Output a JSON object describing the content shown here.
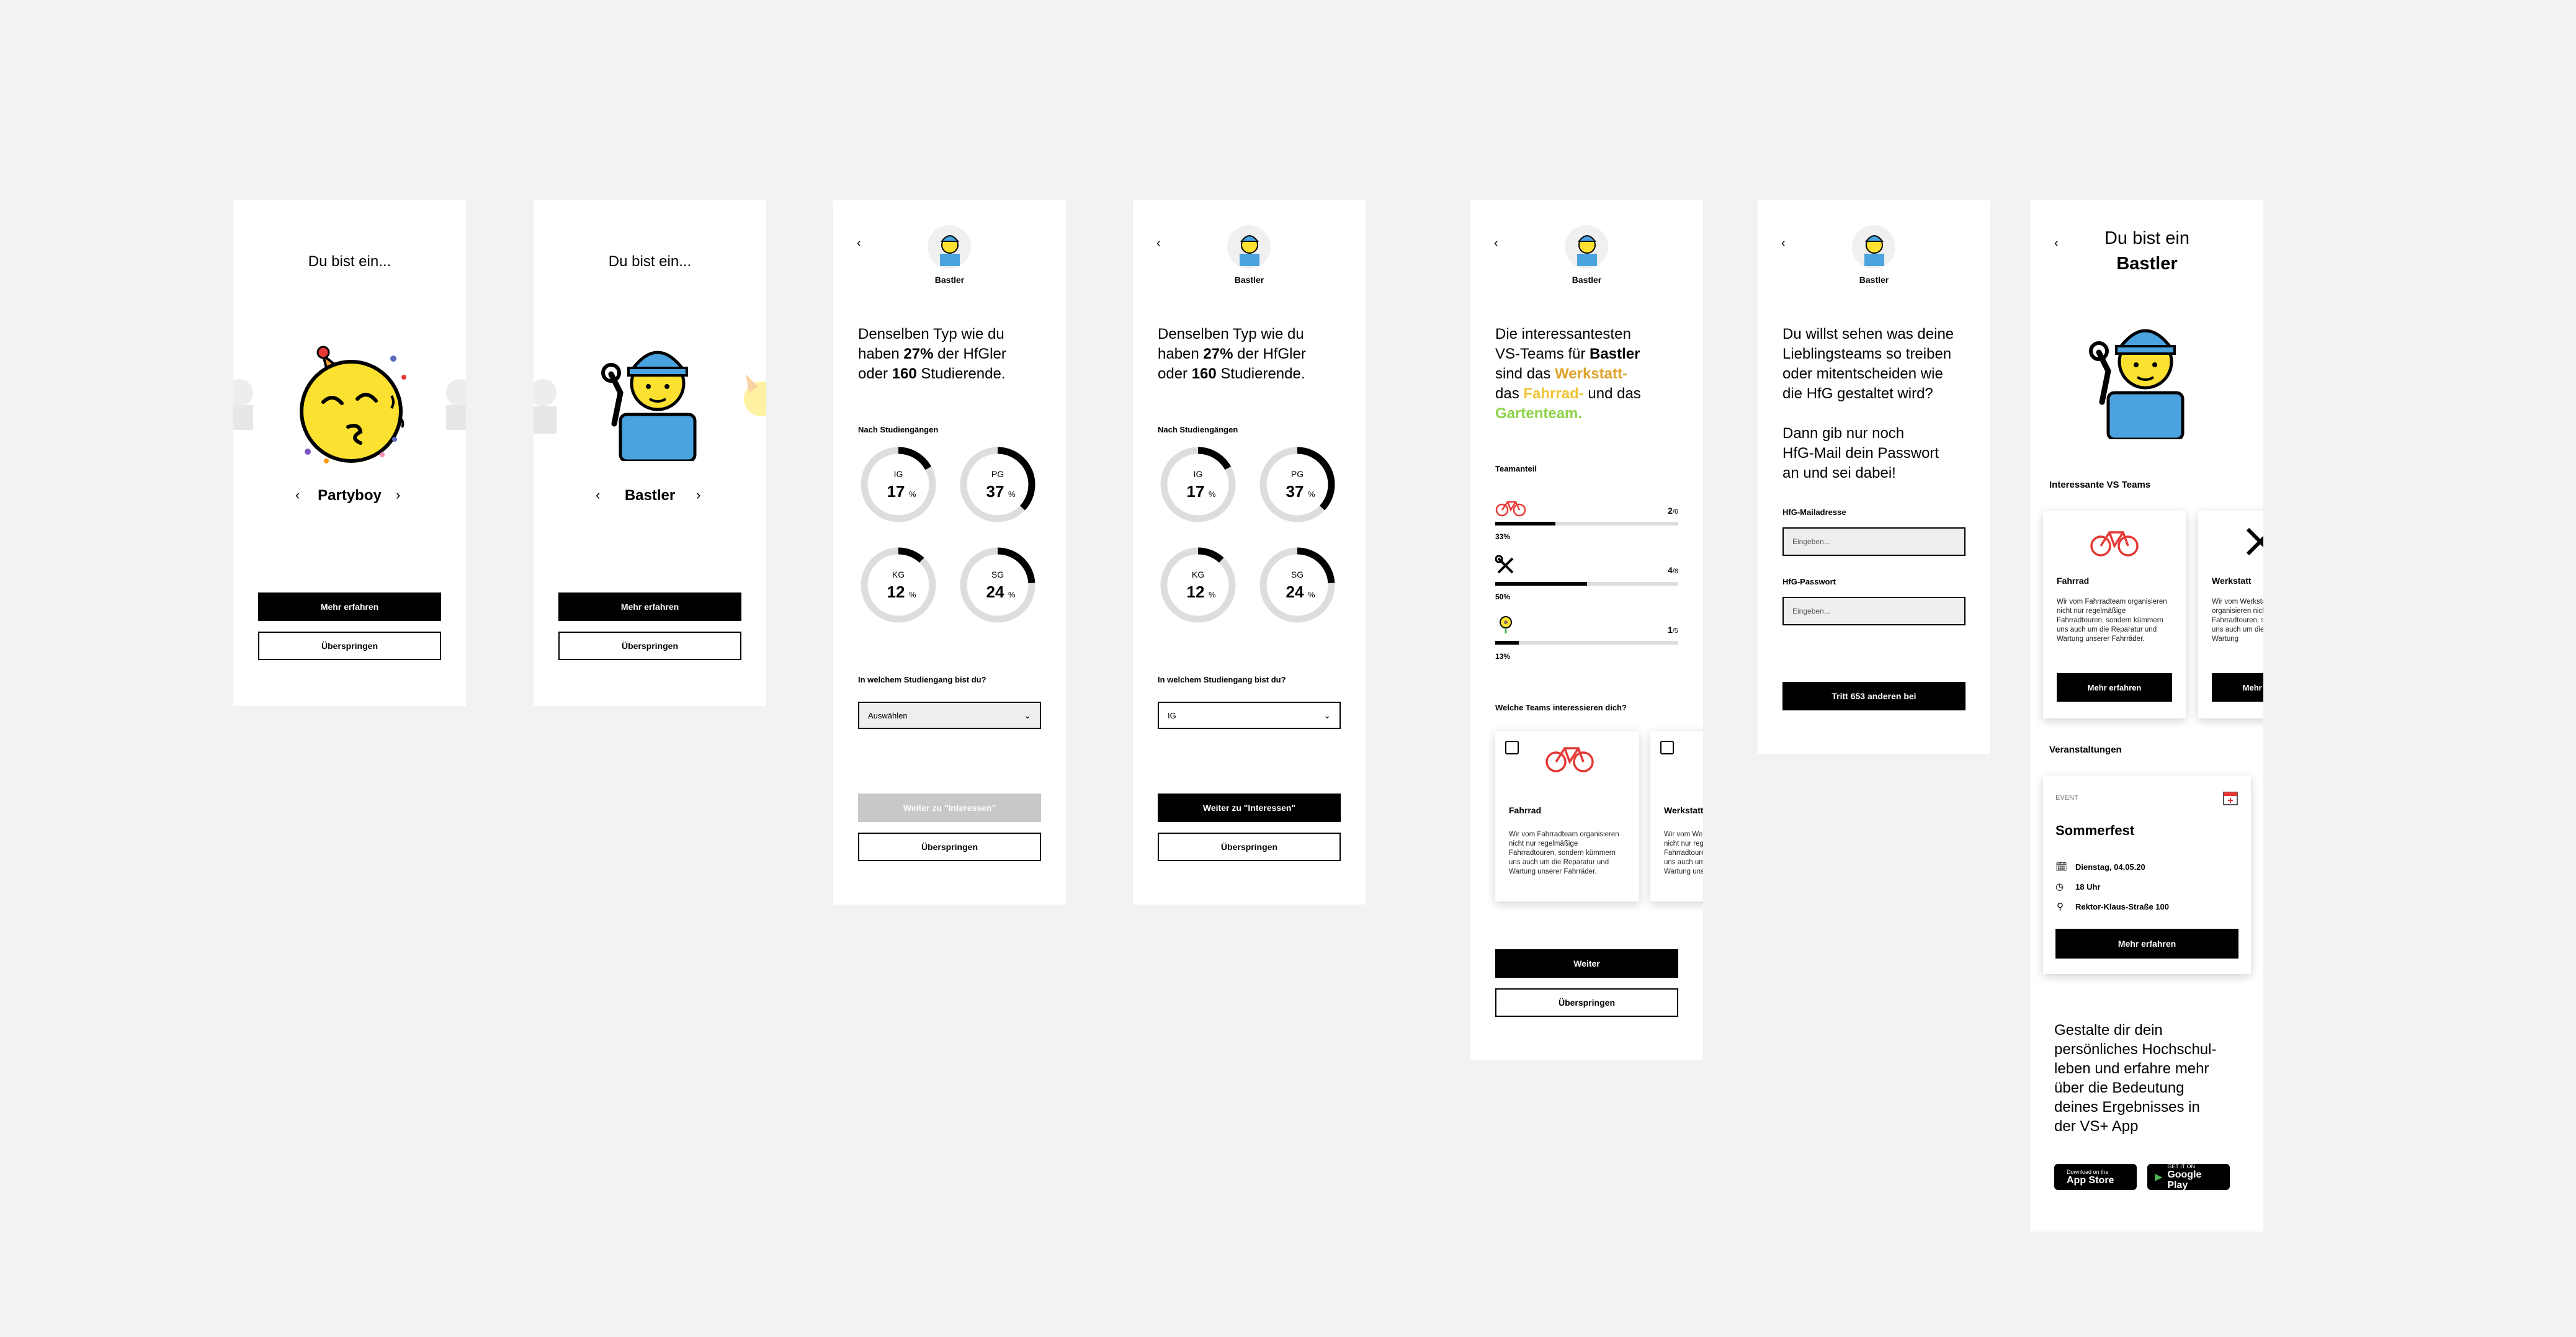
{
  "screen1": {
    "title": "Du bist ein...",
    "type_name": "Partyboy",
    "prev": "‹",
    "next": "›",
    "primary_button": "Mehr erfahren",
    "secondary_button": "Überspringen",
    "icon": "partying-face-icon"
  },
  "screen2": {
    "title": "Du bist ein...",
    "type_name": "Bastler",
    "prev": "‹",
    "next": "›",
    "primary_button": "Mehr erfahren",
    "secondary_button": "Überspringen",
    "icon": "mechanic-icon"
  },
  "screen3": {
    "back": "‹",
    "avatar_label": "Bastler",
    "heading_parts": [
      "Denselben Typ wie du",
      "haben ",
      "27%",
      " der HfGler",
      "oder ",
      "160",
      " Studierende."
    ],
    "section_title": "Nach Studiengängen",
    "rings": [
      {
        "label": "IG",
        "value": "17",
        "unit": "%",
        "percent": 17
      },
      {
        "label": "PG",
        "value": "37",
        "unit": "%",
        "percent": 37
      },
      {
        "label": "KG",
        "value": "12",
        "unit": "%",
        "percent": 12
      },
      {
        "label": "SG",
        "value": "24",
        "unit": "%",
        "percent": 24
      }
    ],
    "question": "In welchem Studiengang bist du?",
    "select_value": "Auswählen",
    "primary_button": "Weiter zu \"Interessen\"",
    "secondary_button": "Überspringen"
  },
  "screen4": {
    "back": "‹",
    "avatar_label": "Bastler",
    "heading_parts": [
      "Denselben Typ wie du",
      "haben ",
      "27%",
      " der HfGler",
      "oder ",
      "160",
      " Studierende."
    ],
    "section_title": "Nach Studiengängen",
    "rings": [
      {
        "label": "IG",
        "value": "17",
        "unit": "%",
        "percent": 17
      },
      {
        "label": "PG",
        "value": "37",
        "unit": "%",
        "percent": 37
      },
      {
        "label": "KG",
        "value": "12",
        "unit": "%",
        "percent": 12
      },
      {
        "label": "SG",
        "value": "24",
        "unit": "%",
        "percent": 24
      }
    ],
    "question": "In welchem Studiengang bist du?",
    "select_value": "IG",
    "primary_button": "Weiter zu \"Interessen\"",
    "secondary_button": "Überspringen"
  },
  "screen5": {
    "back": "‹",
    "avatar_label": "Bastler",
    "heading": {
      "l1": "Die interessantesten",
      "l2a": "VS-Teams für ",
      "l2b": "Bastler",
      "l3a": "sind das ",
      "l3b": "Werkstatt-",
      "l4a": "das ",
      "l4b": "Fahrrad-",
      "l4c": " und das",
      "l5": "Gartenteam."
    },
    "colors": {
      "werkstatt": "#e0a32c",
      "fahrrad": "#f0c437",
      "garten": "#8ed34a"
    },
    "section_title": "Teamanteil",
    "shares": [
      {
        "icon": "bicycle-icon",
        "rank": "2",
        "rank_of": "/6",
        "percent_label": "33%",
        "percent": 33
      },
      {
        "icon": "tools-icon",
        "rank": "4",
        "rank_of": "/8",
        "percent_label": "50%",
        "percent": 50
      },
      {
        "icon": "flower-icon",
        "rank": "1",
        "rank_of": "/5",
        "percent_label": "13%",
        "percent": 13
      }
    ],
    "question": "Welche Teams interessieren dich?",
    "cards": [
      {
        "title": "Fahrrad",
        "text": "Wir vom Fahrradteam organisieren nicht nur regelmäßige Fahrradtouren, sondern kümmern uns auch um die Reparatur und Wartung unserer Fahrräder."
      },
      {
        "title": "Werkstatt",
        "text": "Wir vom Werkstattteam organisieren nicht nur regelmäßige Fahrradtouren, sondern kümmern uns auch um die Reparatur und Wartung unserer Fahrräder."
      }
    ],
    "primary_button": "Weiter",
    "secondary_button": "Überspringen"
  },
  "screen6": {
    "back": "‹",
    "avatar_label": "Bastler",
    "heading1": [
      "Du willst sehen was deine",
      "Lieblingsteams so treiben",
      "oder mitentscheiden wie",
      "die HfG gestaltet wird?"
    ],
    "heading2": [
      "Dann gib nur noch",
      "HfG-Mail dein Passwort",
      "an und sei dabei!"
    ],
    "mail_label": "HfG-Mailadresse",
    "mail_placeholder": "Eingeben...",
    "password_label": "HfG-Passwort",
    "password_placeholder": "Eingeben...",
    "primary_button": "Tritt 653 anderen bei"
  },
  "screen7": {
    "back": "‹",
    "title_line1": "Du bist ein",
    "title_line2": "Bastler",
    "teams_title": "Interessante VS Teams",
    "team_cards": [
      {
        "title": "Fahrrad",
        "text": "Wir vom Fahrradteam organisieren nicht nur regelmäßige Fahrradtouren, sondern kümmern uns auch um die Reparatur und Wartung unserer Fahrräder.",
        "button": "Mehr erfahren"
      },
      {
        "title": "Werkstatt",
        "text": "Wir vom Werkstattteam organisieren nicht nur regelmäßige Fahrradtouren, sondern kümmern uns auch um die Reparatur und Wartung",
        "button": "Mehr erfahren"
      }
    ],
    "events_title": "Veranstaltungen",
    "event": {
      "tag": "EVENT",
      "title": "Sommerfest",
      "date": "Dienstag, 04.05.20",
      "time": "18 Uhr",
      "place": "Rektor-Klaus-Straße 100",
      "button": "Mehr erfahren"
    },
    "closing": [
      "Gestalte dir dein",
      "persönliches Hochschul-",
      "leben und erfahre mehr",
      "über die Bedeutung",
      "deines Ergebnisses in",
      "der VS+ App"
    ],
    "appstore_small": "Download on the",
    "appstore_big": "App Store",
    "playstore_small": "GET IT ON",
    "playstore_big": "Google Play"
  }
}
